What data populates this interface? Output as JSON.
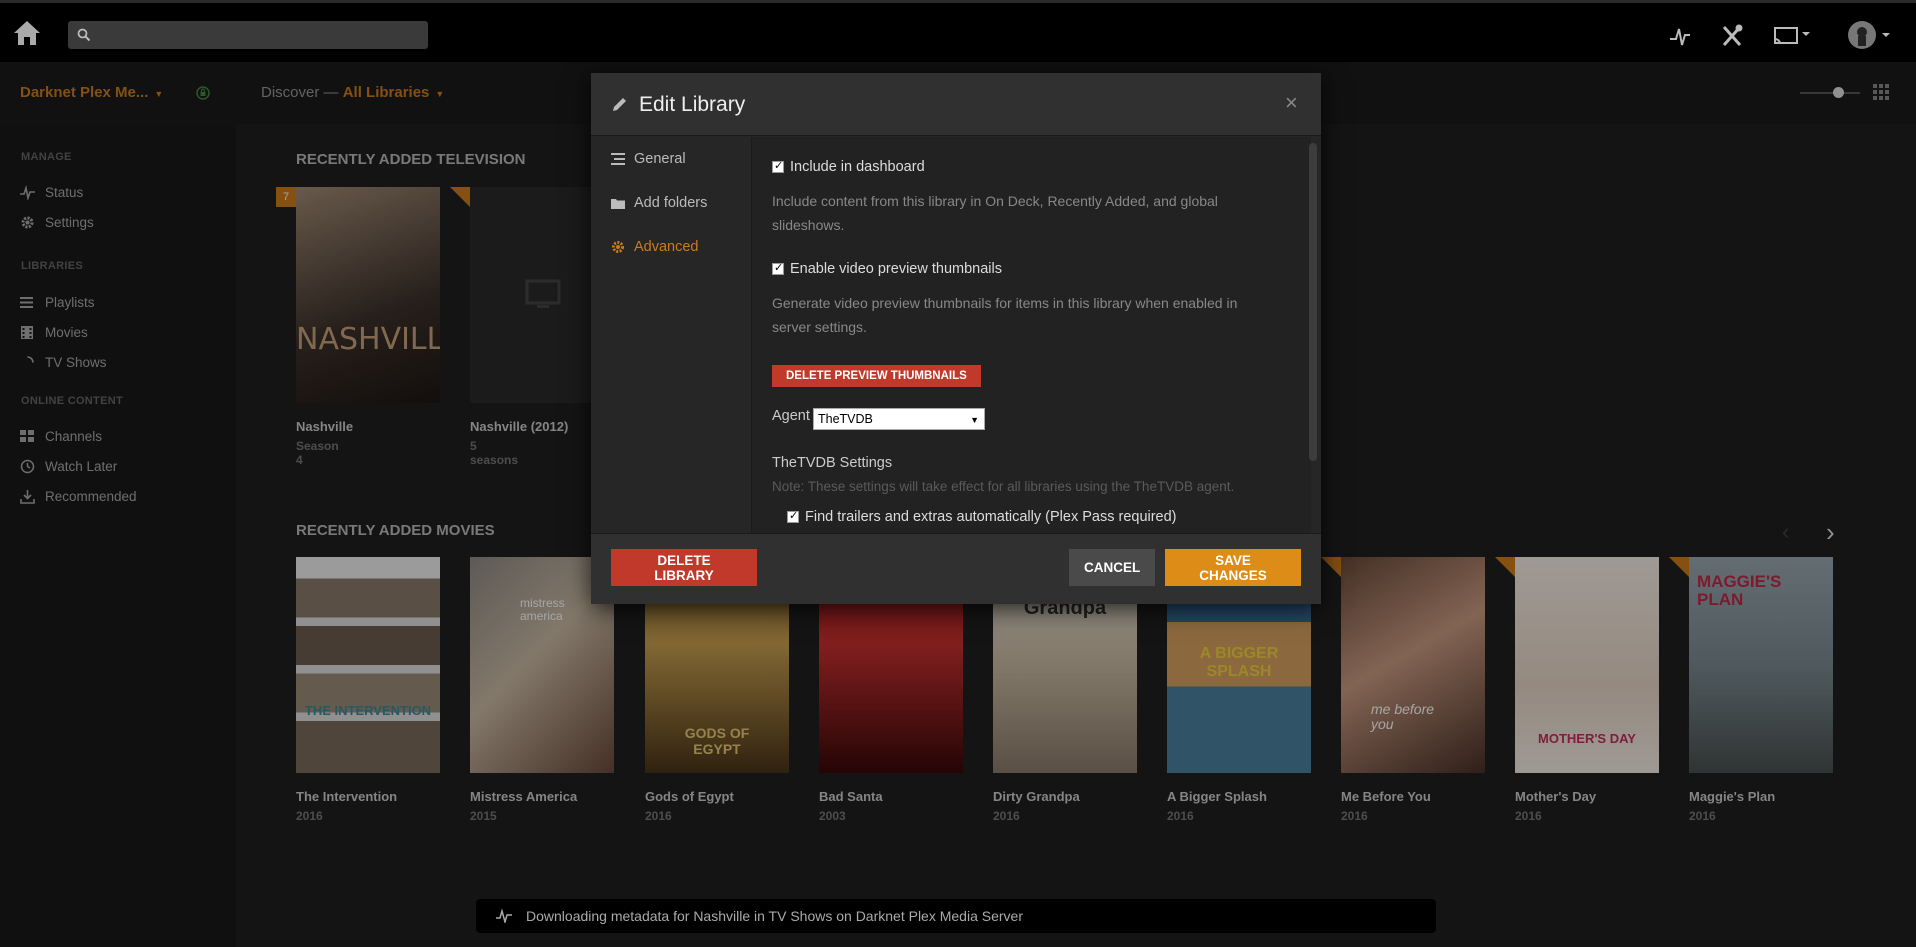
{
  "topbar": {
    "search_placeholder": ""
  },
  "secondary_bar": {
    "server_name": "Darknet Plex Me...",
    "crumb_discover": "Discover",
    "crumb_sep": " — ",
    "crumb_all": "All Libraries"
  },
  "sidebar": {
    "manage_head": "MANAGE",
    "status": "Status",
    "settings": "Settings",
    "libraries_head": "LIBRARIES",
    "playlists": "Playlists",
    "movies": "Movies",
    "tvshows": "TV Shows",
    "online_head": "ONLINE CONTENT",
    "channels": "Channels",
    "watch_later": "Watch Later",
    "recommended": "Recommended"
  },
  "main": {
    "recent_tv_title": "RECENTLY ADDED TELEVISION",
    "tv": [
      {
        "title": "Nashville",
        "sub": "Season 4",
        "badge": "7"
      },
      {
        "title": "Nashville (2012)",
        "sub": "5 seasons"
      }
    ],
    "recent_movies_title": "RECENTLY ADDED MOVIES",
    "movies": [
      {
        "title": "The Intervention",
        "year": "2016"
      },
      {
        "title": "Mistress America",
        "year": "2015"
      },
      {
        "title": "Gods of Egypt",
        "year": "2016"
      },
      {
        "title": "Bad Santa",
        "year": "2003"
      },
      {
        "title": "Dirty Grandpa",
        "year": "2016"
      },
      {
        "title": "A Bigger Splash",
        "year": "2016"
      },
      {
        "title": "Me Before You",
        "year": "2016"
      },
      {
        "title": "Mother's Day",
        "year": "2016"
      },
      {
        "title": "Maggie's Plan",
        "year": "2016"
      }
    ],
    "poster_texts": {
      "nashville": "NASHVILLE",
      "intervention": "THE INTERVENTION",
      "mistress": "mistress america",
      "gods": "GODS OF EGYPT",
      "grandpa": "Grandpa",
      "splash": "A BIGGER SPLASH",
      "mebefore": "me before you",
      "mothers": "MOTHER'S DAY",
      "maggie": "MAGGIE'S PLAN"
    }
  },
  "toast": {
    "text": "Downloading metadata for Nashville in TV Shows on Darknet Plex Media Server"
  },
  "modal": {
    "title": "Edit Library",
    "close": "×",
    "nav": {
      "general": "General",
      "add_folders": "Add folders",
      "advanced": "Advanced"
    },
    "include_dashboard_label": "Include in dashboard",
    "include_dashboard_desc": "Include content from this library in On Deck, Recently Added, and global slideshows.",
    "enable_thumbs_label": "Enable video preview thumbnails",
    "enable_thumbs_desc": "Generate video preview thumbnails for items in this library when enabled in server settings.",
    "delete_thumbs_button": "DELETE PREVIEW THUMBNAILS",
    "agent_label": "Agent",
    "agent_value": "TheTVDB",
    "settings_head": "TheTVDB Settings",
    "settings_note": "Note: These settings will take effect for all libraries using the TheTVDB agent.",
    "trailers_label": "Find trailers and extras automatically (Plex Pass required)",
    "delete_library_button": "DELETE LIBRARY",
    "cancel_button": "CANCEL",
    "save_button": "SAVE CHANGES"
  },
  "colors": {
    "accent": "#cc7b19",
    "danger": "#c0392b",
    "save": "#dc8c17"
  }
}
